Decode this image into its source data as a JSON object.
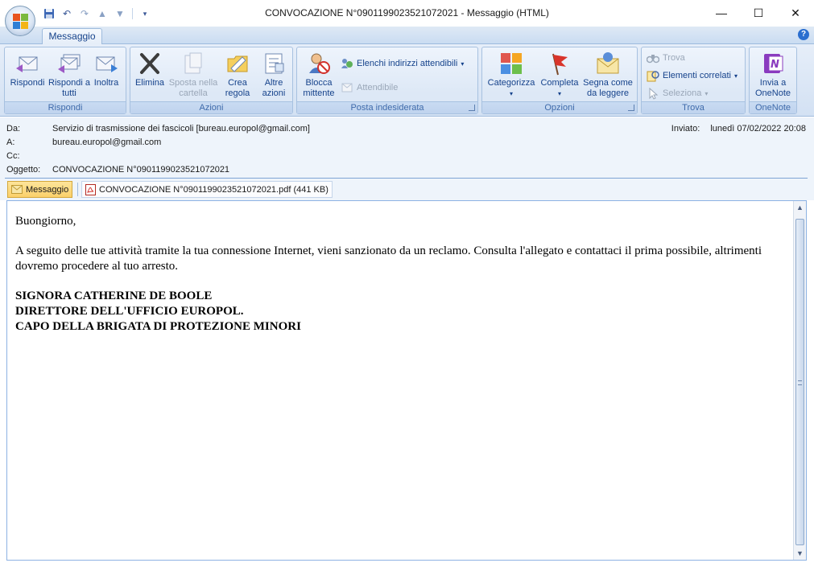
{
  "window": {
    "title": "CONVOCAZIONE N°0901199023521072021 - Messaggio (HTML)",
    "minimize_glyph": "—",
    "maximize_glyph": "☐",
    "close_glyph": "✕"
  },
  "quick_access": {
    "items": [
      "save-icon",
      "undo-icon",
      "redo-icon",
      "up-arrow-icon",
      "down-arrow-icon",
      "customize-icon"
    ]
  },
  "ribbon": {
    "active_tab": "Messaggio",
    "help_glyph": "?",
    "groups": {
      "rispondi": {
        "label": "Rispondi",
        "buttons": [
          {
            "label": "Rispondi",
            "icon": "reply-icon"
          },
          {
            "label": "Rispondi a tutti",
            "icon": "reply-all-icon"
          },
          {
            "label": "Inoltra",
            "icon": "forward-icon"
          }
        ]
      },
      "azioni": {
        "label": "Azioni",
        "buttons": [
          {
            "label": "Elimina",
            "icon": "delete-icon"
          },
          {
            "label": "Sposta nella cartella",
            "icon": "move-to-folder-icon",
            "disabled": true
          },
          {
            "label": "Crea regola",
            "icon": "create-rule-icon"
          },
          {
            "label": "Altre azioni",
            "icon": "other-actions-icon"
          }
        ]
      },
      "posta_indesiderata": {
        "label": "Posta indesiderata",
        "block_label": "Blocca mittente",
        "safe_lists_label": "Elenchi indirizzi attendibili",
        "trusted_label": "Attendibile"
      },
      "opzioni": {
        "label": "Opzioni",
        "buttons": [
          {
            "label": "Categorizza",
            "icon": "categorize-icon"
          },
          {
            "label": "Completa",
            "icon": "follow-up-flag-icon"
          },
          {
            "label": "Segna come da leggere",
            "icon": "mark-unread-icon"
          }
        ]
      },
      "trova": {
        "label": "Trova",
        "find_label": "Trova",
        "related_label": "Elementi correlati",
        "select_label": "Seleziona"
      },
      "onenote": {
        "label": "OneNote",
        "send_label": "Invia a OneNote"
      }
    }
  },
  "header": {
    "from_label": "Da:",
    "from_value": "Servizio di trasmissione dei fascicoli [bureau.europol@gmail.com]",
    "to_label": "A:",
    "to_value": "bureau.europol@gmail.com",
    "cc_label": "Cc:",
    "cc_value": "",
    "subject_label": "Oggetto:",
    "subject_value": "CONVOCAZIONE N°0901199023521072021",
    "sent_label": "Inviato:",
    "sent_value": "lunedì 07/02/2022 20:08"
  },
  "attachments": {
    "message_tab": "Messaggio",
    "file": "CONVOCAZIONE N°0901199023521072021.pdf (441 KB)"
  },
  "message": {
    "greeting": "Buongiorno,",
    "paragraph": " A seguito delle tue attività tramite la tua connessione Internet, vieni sanzionato da un reclamo. Consulta l'allegato e contattaci il prima possibile, altrimenti dovremo procedere al tuo arresto.",
    "signature": [
      "SIGNORA CATHERINE DE BOOLE",
      "DIRETTORE DELL'UFFICIO EUROPOL.",
      "CAPO DELLA BRIGATA DI PROTEZIONE MINORI"
    ]
  }
}
